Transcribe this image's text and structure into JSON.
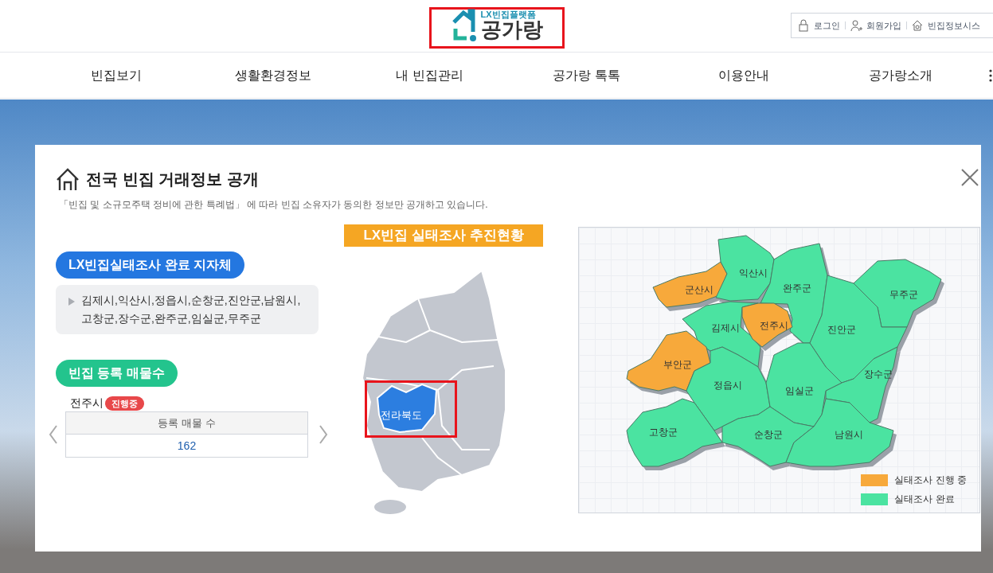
{
  "header": {
    "logo": {
      "tagline": "LX빈집플랫폼",
      "name": "공가랑",
      "highlighted": true
    },
    "util_links": [
      "로그인",
      "회원가입",
      "빈집정보시스"
    ]
  },
  "nav": [
    "빈집보기",
    "생활환경정보",
    "내 빈집관리",
    "공가랑 톡톡",
    "이용안내",
    "공가랑소개"
  ],
  "modal": {
    "title": "전국 빈집 거래정보 공개",
    "subtitle": "「빈집 및 소규모주택 정비에 관한 특례법」 에 따라 빈집 소유자가 동의한 정보만 공개하고 있습니다.",
    "completed": {
      "heading": "LX빈집실태조사 완료 지자체",
      "lines": [
        "김제시,익산시,정읍시,순창군,진안군,남원시,",
        "고창군,장수군,완주군,임실군,무주군"
      ]
    },
    "listings": {
      "heading": "빈집 등록 매물수",
      "city": "전주시",
      "badge": "진행중",
      "column": "등록 매물 수",
      "value": "162"
    },
    "map_title": "LX빈집 실태조사 추진현황",
    "korea_map": {
      "region_label": "전라북도",
      "highlighted": true
    },
    "regions": [
      {
        "name": "군산시",
        "kind": "in_progress"
      },
      {
        "name": "익산시",
        "kind": "done"
      },
      {
        "name": "완주군",
        "kind": "done"
      },
      {
        "name": "무주군",
        "kind": "done"
      },
      {
        "name": "김제시",
        "kind": "done"
      },
      {
        "name": "전주시",
        "kind": "in_progress"
      },
      {
        "name": "진안군",
        "kind": "done"
      },
      {
        "name": "부안군",
        "kind": "in_progress"
      },
      {
        "name": "장수군",
        "kind": "done"
      },
      {
        "name": "정읍시",
        "kind": "done"
      },
      {
        "name": "임실군",
        "kind": "done"
      },
      {
        "name": "고창군",
        "kind": "done"
      },
      {
        "name": "순창군",
        "kind": "done"
      },
      {
        "name": "남원시",
        "kind": "done"
      }
    ],
    "legend": [
      {
        "label": "실태조사 진행 중",
        "color": "#f7a93b"
      },
      {
        "label": "실태조사 완료",
        "color": "#4be3a1"
      }
    ]
  }
}
